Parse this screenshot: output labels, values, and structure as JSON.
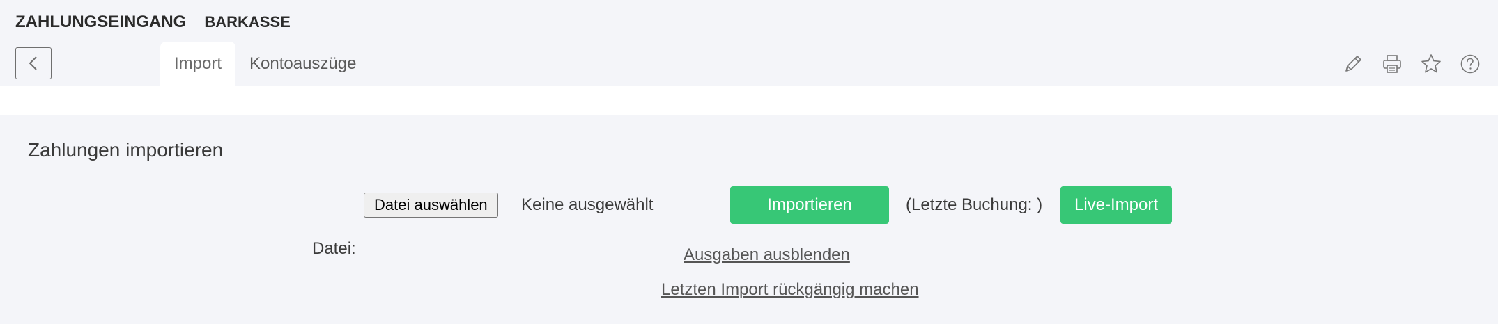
{
  "header": {
    "title": "ZAHLUNGSEINGANG",
    "subtitle": "BARKASSE"
  },
  "tabs": [
    {
      "label": "Import",
      "active": true
    },
    {
      "label": "Kontoauszüge",
      "active": false
    }
  ],
  "toolbar": {
    "icons": [
      "back-icon",
      "pencil-icon",
      "printer-icon",
      "star-icon",
      "help-icon"
    ]
  },
  "main": {
    "section_title": "Zahlungen importieren",
    "file_button_label": "Datei auswählen",
    "file_status": "Keine ausgewählt",
    "import_button_label": "Importieren",
    "last_booking_text": "(Letzte Buchung: )",
    "live_import_button_label": "Live-Import",
    "file_label": "Datei:",
    "hide_expenses_link": "Ausgaben ausblenden",
    "undo_import_link": "Letzten Import rückgängig machen"
  },
  "colors": {
    "accent_green": "#37c776",
    "background": "#f4f5f9",
    "tab_active": "#ffffff"
  }
}
